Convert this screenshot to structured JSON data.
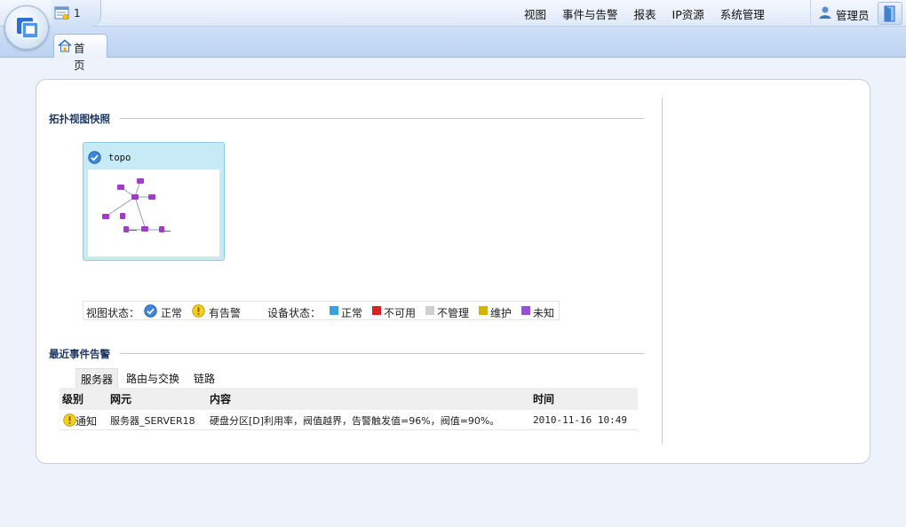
{
  "header": {
    "doc_count": "1",
    "nav": [
      "视图",
      "事件与告警",
      "报表",
      "IP资源",
      "系统管理"
    ],
    "user": "管理员",
    "home_tab": "首 页"
  },
  "topology": {
    "title": "拓扑视图快照",
    "card_name": "topo"
  },
  "legend": {
    "view_status_label": "视图状态：",
    "view_normal": "正常",
    "view_alarm": "有告警",
    "device_status_label": "设备状态：",
    "device_items": [
      {
        "label": "正常",
        "color": "#3aa0e0"
      },
      {
        "label": "不可用",
        "color": "#d42424"
      },
      {
        "label": "不管理",
        "color": "#cfcfcf"
      },
      {
        "label": "维护",
        "color": "#d4b400"
      },
      {
        "label": "未知",
        "color": "#9a4fd8"
      }
    ]
  },
  "events": {
    "title": "最近事件告警",
    "tabs": [
      "服务器",
      "路由与交换",
      "链路"
    ],
    "columns": [
      "级别",
      "网元",
      "内容",
      "时间"
    ],
    "rows": [
      {
        "level": "通知",
        "element": "服务器_SERVER18",
        "content": "硬盘分区[D]利用率，阀值越界，告警触发值=96%，阀值=90%。",
        "time": "2010-11-16 10:49"
      }
    ]
  }
}
